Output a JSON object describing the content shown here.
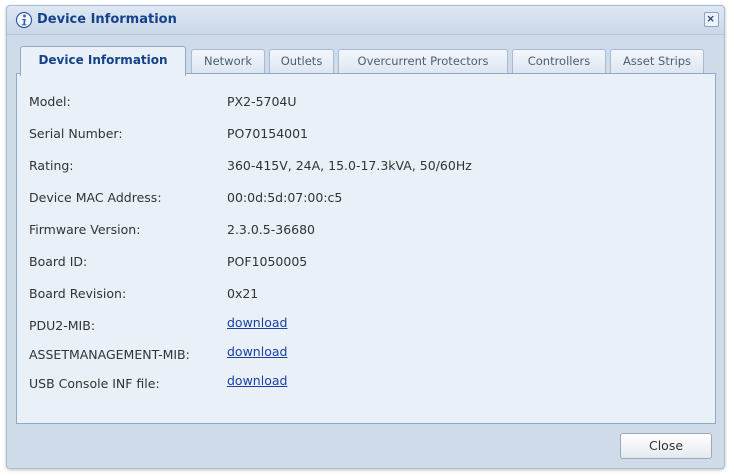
{
  "dialog": {
    "title": "Device Information",
    "icon": "info-icon",
    "close_icon": "close-icon"
  },
  "tabs": [
    {
      "label": "Device Information",
      "active": true
    },
    {
      "label": "Network",
      "active": false
    },
    {
      "label": "Outlets",
      "active": false
    },
    {
      "label": "Overcurrent Protectors",
      "active": false
    },
    {
      "label": "Controllers",
      "active": false
    },
    {
      "label": "Asset Strips",
      "active": false
    }
  ],
  "fields": [
    {
      "label": "Model:",
      "value": "PX2-5704U"
    },
    {
      "label": "Serial Number:",
      "value": "PO70154001"
    },
    {
      "label": "Rating:",
      "value": "360-415V, 24A, 15.0-17.3kVA, 50/60Hz"
    },
    {
      "label": "Device MAC Address:",
      "value": "00:0d:5d:07:00:c5"
    },
    {
      "label": "Firmware Version:",
      "value": "2.3.0.5-36680"
    },
    {
      "label": "Board ID:",
      "value": "POF1050005"
    },
    {
      "label": "Board Revision:",
      "value": "0x21"
    },
    {
      "label": "PDU2-MIB:",
      "value": "download"
    },
    {
      "label": "ASSETMANAGEMENT-MIB:",
      "value": "download"
    },
    {
      "label": "USB Console INF file:",
      "value": "download"
    }
  ],
  "footer": {
    "close_label": "Close"
  },
  "colors": {
    "title": "#15428b",
    "link": "#1a3fa6",
    "frame": "#cfdbe9",
    "panel": "#e9f0f8"
  }
}
